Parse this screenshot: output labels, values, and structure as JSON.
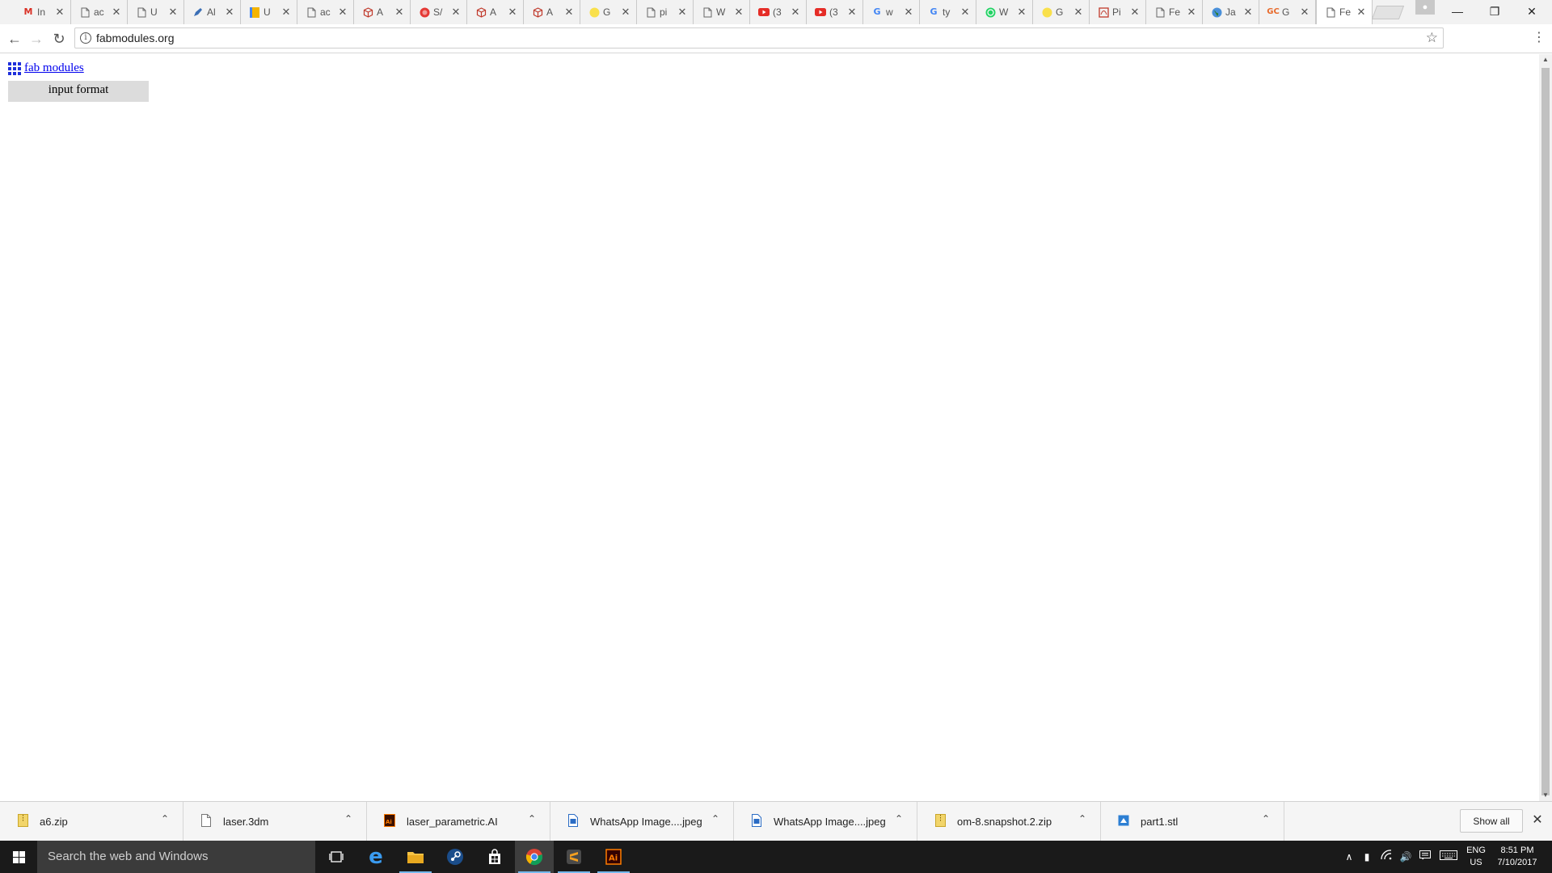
{
  "browser": {
    "tabs": [
      {
        "title": "In",
        "icon": "gmail-icon",
        "color": "#d93025"
      },
      {
        "title": "ac",
        "icon": "page-icon",
        "color": "#666666"
      },
      {
        "title": "U",
        "icon": "page-icon",
        "color": "#666666"
      },
      {
        "title": "Al",
        "icon": "pen-icon",
        "color": "#3b6fb6"
      },
      {
        "title": "U",
        "icon": "drive-icon",
        "color": "#f4b400"
      },
      {
        "title": "ac",
        "icon": "page-icon",
        "color": "#666666"
      },
      {
        "title": "A",
        "icon": "cube-icon",
        "color": "#c0392b"
      },
      {
        "title": "S/",
        "icon": "red-circle-icon",
        "color": "#e53935"
      },
      {
        "title": "A",
        "icon": "cube-icon",
        "color": "#c0392b"
      },
      {
        "title": "A",
        "icon": "cube-icon",
        "color": "#c0392b"
      },
      {
        "title": "G",
        "icon": "yellow-circle-icon",
        "color": "#f9e04b"
      },
      {
        "title": "pi",
        "icon": "page-icon",
        "color": "#666666"
      },
      {
        "title": "W",
        "icon": "page-icon",
        "color": "#666666"
      },
      {
        "title": "(3",
        "icon": "youtube-icon",
        "color": "#e52d27"
      },
      {
        "title": "(3",
        "icon": "youtube-icon",
        "color": "#e52d27"
      },
      {
        "title": "w",
        "icon": "google-icon",
        "color": "#4285f4"
      },
      {
        "title": "ty",
        "icon": "google-icon",
        "color": "#4285f4"
      },
      {
        "title": "W",
        "icon": "whatsapp-icon",
        "color": "#25d366"
      },
      {
        "title": "G",
        "icon": "yellow-circle-icon",
        "color": "#f9e04b"
      },
      {
        "title": "Pi",
        "icon": "pdf-icon",
        "color": "#c0392b"
      },
      {
        "title": "Fe",
        "icon": "page-icon",
        "color": "#666666"
      },
      {
        "title": "Ja",
        "icon": "globe-icon",
        "color": "#2e7d32"
      },
      {
        "title": "G",
        "icon": "gc-icon",
        "color": "#e86a2b"
      },
      {
        "title": "Fe",
        "icon": "page-icon",
        "color": "#666666",
        "active": true
      }
    ],
    "address": "fabmodules.org"
  },
  "page": {
    "brand_label": "fab modules",
    "input_format_label": "input format"
  },
  "downloads": {
    "items": [
      {
        "name": "a6.zip",
        "icon": "zip-icon"
      },
      {
        "name": "laser.3dm",
        "icon": "file-icon"
      },
      {
        "name": "laser_parametric.AI",
        "icon": "illustrator-file-icon"
      },
      {
        "name": "WhatsApp Image....jpeg",
        "icon": "image-file-icon"
      },
      {
        "name": "WhatsApp Image....jpeg",
        "icon": "image-file-icon"
      },
      {
        "name": "om-8.snapshot.2.zip",
        "icon": "zip-icon"
      },
      {
        "name": "part1.stl",
        "icon": "stl-file-icon"
      }
    ],
    "show_all_label": "Show all"
  },
  "taskbar": {
    "search_placeholder": "Search the web and Windows",
    "lang_line1": "ENG",
    "lang_line2": "US",
    "time": "8:51 PM",
    "date": "7/10/2017"
  }
}
